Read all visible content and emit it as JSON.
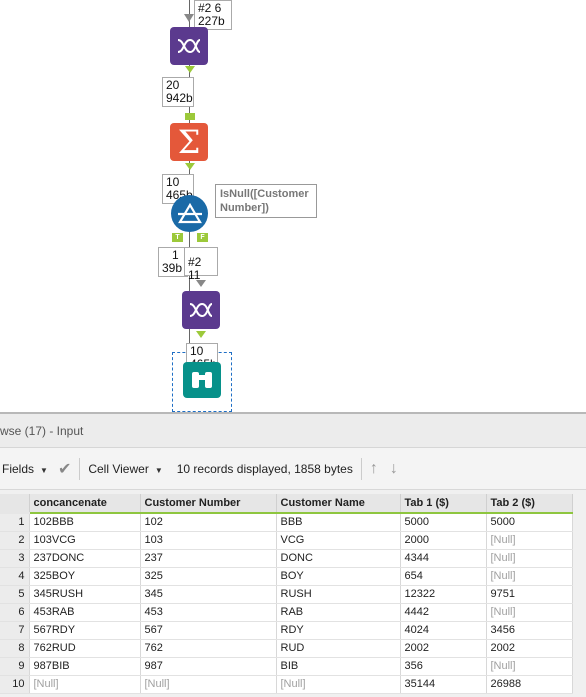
{
  "workflow": {
    "top_badge": {
      "line1": "#2 6",
      "line2": "227b"
    },
    "badge_20": {
      "line1": "20",
      "line2": "942b"
    },
    "badge_10a": {
      "line1": "10",
      "line2": "465b"
    },
    "filter_anno": "IsNull([Customer Number])",
    "t_label": "T",
    "f_label": "F",
    "badge_t": {
      "line1": "1",
      "line2": "39b"
    },
    "badge_f": {
      "line1": "#2 ⁰",
      "line2": "¹¹"
    },
    "badge_f_text": "#2 11",
    "badge_10b": {
      "line1": "10",
      "line2": "465b"
    },
    "sum_symbol": "Σ"
  },
  "pane": {
    "title": "wse (17) - Input",
    "fields_label": "Fields",
    "cell_viewer_label": "Cell Viewer",
    "status": "10 records displayed, 1858 bytes"
  },
  "table": {
    "columns": [
      "concancenate",
      "Customer Number",
      "Customer Name",
      "Tab 1 ($)",
      "Tab 2 ($)"
    ],
    "rows": [
      [
        "1",
        "102BBB",
        "102",
        "BBB",
        "5000",
        "5000"
      ],
      [
        "2",
        "103VCG",
        "103",
        "VCG",
        "2000",
        "[Null]"
      ],
      [
        "3",
        "237DONC",
        "237",
        "DONC",
        "4344",
        "[Null]"
      ],
      [
        "4",
        "325BOY",
        "325",
        "BOY",
        "654",
        "[Null]"
      ],
      [
        "5",
        "345RUSH",
        "345",
        "RUSH",
        "12322",
        "9751"
      ],
      [
        "6",
        "453RAB",
        "453",
        "RAB",
        "4442",
        "[Null]"
      ],
      [
        "7",
        "567RDY",
        "567",
        "RDY",
        "4024",
        "3456"
      ],
      [
        "8",
        "762RUD",
        "762",
        "RUD",
        "2002",
        "2002"
      ],
      [
        "9",
        "987BIB",
        "987",
        "BIB",
        "356",
        "[Null]"
      ],
      [
        "10",
        "[Null]",
        "[Null]",
        "[Null]",
        "35144",
        "26988"
      ]
    ]
  }
}
